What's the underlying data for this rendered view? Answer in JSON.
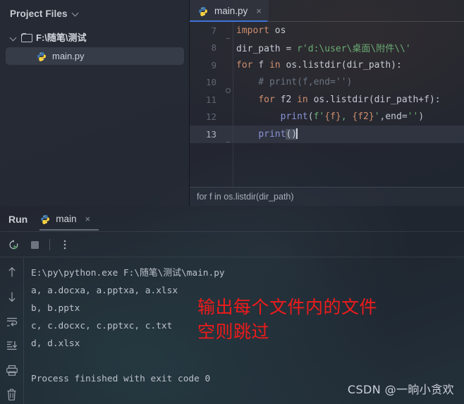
{
  "project": {
    "header_title": "Project Files",
    "header_chevron": "chevron-down-icon",
    "folder": {
      "label": "F:\\随笔\\测试",
      "icon": "folder-icon",
      "arrow": "chevron-down-icon"
    },
    "file": {
      "label": "main.py",
      "icon": "python-file-icon"
    }
  },
  "editor": {
    "tab": {
      "label": "main.py",
      "icon": "python-file-icon",
      "close": "×"
    },
    "accent_color": "#3e72d6",
    "breadcrumb": "for f in os.listdir(dir_path)",
    "lines": [
      {
        "num": "7",
        "fold": "dash",
        "current": false,
        "tokens": [
          {
            "t": "import ",
            "c": "kw"
          },
          {
            "t": "os",
            "c": "id"
          }
        ]
      },
      {
        "num": "8",
        "fold": "none",
        "current": false,
        "tokens": [
          {
            "t": "dir_path ",
            "c": "id"
          },
          {
            "t": "= ",
            "c": "pn"
          },
          {
            "t": "r'd:\\user\\桌面\\附件\\\\'",
            "c": "str"
          }
        ]
      },
      {
        "num": "9",
        "fold": "none",
        "current": false,
        "tokens": [
          {
            "t": "for ",
            "c": "kw"
          },
          {
            "t": "f ",
            "c": "id"
          },
          {
            "t": "in ",
            "c": "kw"
          },
          {
            "t": "os.listdir(dir_path):",
            "c": "id"
          }
        ]
      },
      {
        "num": "10",
        "fold": "circle",
        "current": false,
        "tokens": [
          {
            "t": "    # print(f,end='')",
            "c": "com"
          }
        ]
      },
      {
        "num": "11",
        "fold": "none",
        "current": false,
        "tokens": [
          {
            "t": "    ",
            "c": "pn"
          },
          {
            "t": "for ",
            "c": "kw"
          },
          {
            "t": "f2 ",
            "c": "id"
          },
          {
            "t": "in ",
            "c": "kw"
          },
          {
            "t": "os.listdir(dir_path+f):",
            "c": "id"
          }
        ]
      },
      {
        "num": "12",
        "fold": "none",
        "current": false,
        "tokens": [
          {
            "t": "        ",
            "c": "pn"
          },
          {
            "t": "print",
            "c": "fn"
          },
          {
            "t": "(",
            "c": "pn"
          },
          {
            "t": "f'",
            "c": "str"
          },
          {
            "t": "{f}",
            "c": "brc"
          },
          {
            "t": ", ",
            "c": "str"
          },
          {
            "t": "{f2}",
            "c": "brc"
          },
          {
            "t": "'",
            "c": "str"
          },
          {
            "t": ",",
            "c": "pn"
          },
          {
            "t": "end",
            "c": "id"
          },
          {
            "t": "=",
            "c": "pn"
          },
          {
            "t": "''",
            "c": "str"
          },
          {
            "t": ")",
            "c": "pn"
          }
        ]
      },
      {
        "num": "13",
        "fold": "dash",
        "current": true,
        "tokens": [
          {
            "t": "    ",
            "c": "pn"
          },
          {
            "t": "print",
            "c": "fn"
          },
          {
            "t": "()",
            "c": "pn sel"
          }
        ],
        "cursor": true
      }
    ]
  },
  "run_panel": {
    "label": "Run",
    "tab": {
      "label": "main",
      "icon": "python-file-icon",
      "close": "×"
    },
    "toolbar": [
      {
        "name": "rerun-button",
        "icon": "rerun-icon"
      },
      {
        "name": "stop-button",
        "icon": "stop-square-icon"
      },
      {
        "name": "more-options-button",
        "icon": "more-vertical-icon"
      }
    ],
    "side_toolbar": [
      {
        "name": "scroll-up-button",
        "icon": "arrow-up-icon"
      },
      {
        "name": "scroll-down-button",
        "icon": "arrow-down-icon"
      },
      {
        "name": "soft-wrap-button",
        "icon": "soft-wrap-icon"
      },
      {
        "name": "scroll-to-end-button",
        "icon": "scroll-to-end-icon"
      },
      {
        "name": "print-button",
        "icon": "printer-icon"
      },
      {
        "name": "clear-all-button",
        "icon": "trash-icon"
      }
    ],
    "console_lines": [
      "E:\\py\\python.exe F:\\随笔\\测试\\main.py",
      "a, a.docxa, a.pptxa, a.xlsx",
      "b, b.pptx",
      "c, c.docxc, c.pptxc, c.txt",
      "d, d.xlsx"
    ],
    "console_final": "Process finished with exit code 0"
  },
  "annotation": {
    "line1": "输出每个文件内的文件",
    "line2": "空则跳过",
    "color": "#ef1b1b"
  },
  "watermark": "CSDN @一晌小贪欢"
}
